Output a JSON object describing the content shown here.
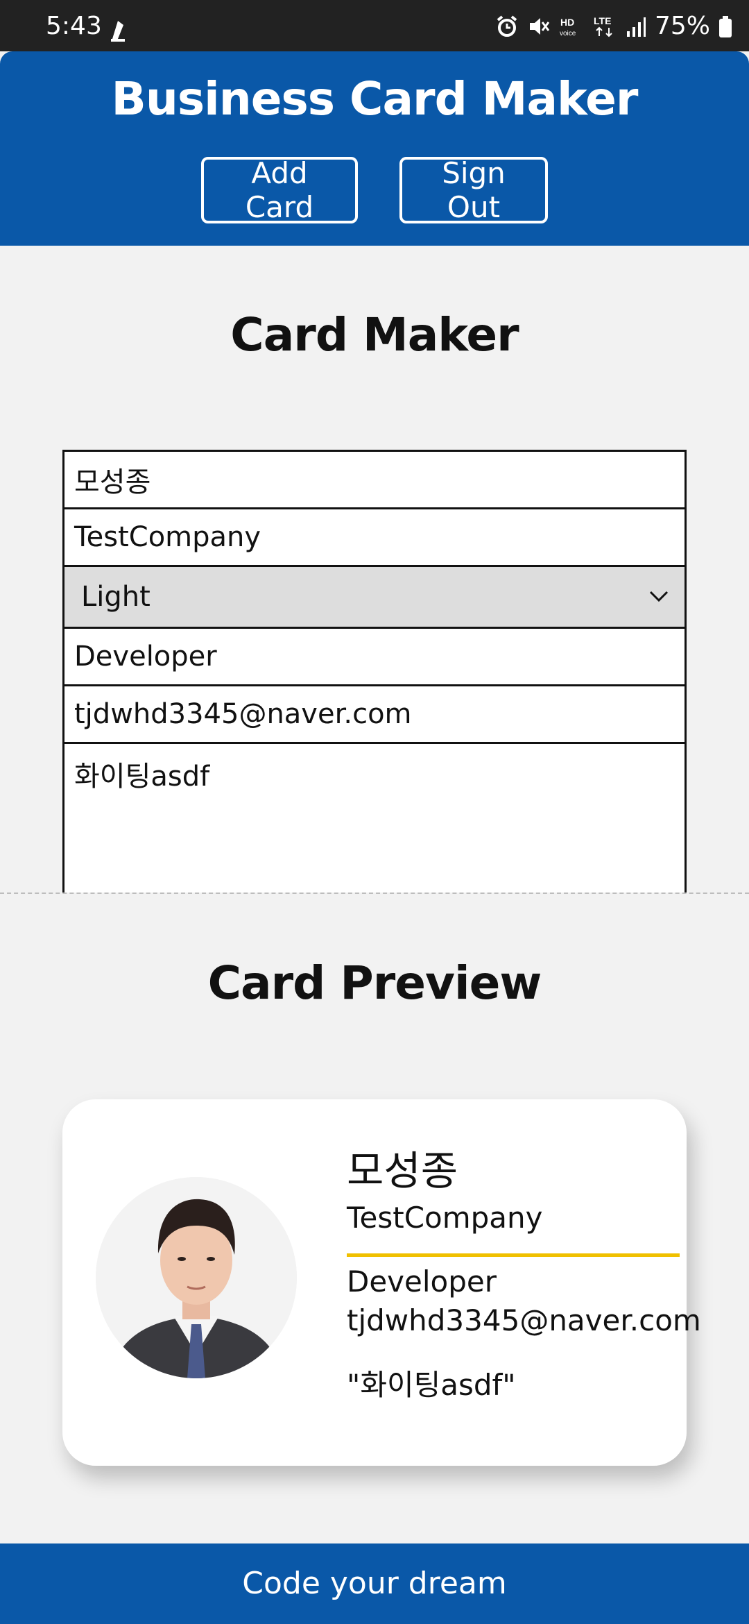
{
  "status_bar": {
    "time": "5:43",
    "battery": "75%",
    "icons": [
      "notification-icon",
      "alarm-icon",
      "mute-icon",
      "hd-voice-icon",
      "lte-icon",
      "signal-icon",
      "battery-icon"
    ]
  },
  "header": {
    "title": "Business Card Maker",
    "add_card_label": "Add Card",
    "sign_out_label": "Sign Out"
  },
  "maker": {
    "title": "Card Maker",
    "name_value": "모성종",
    "company_value": "TestCompany",
    "theme_value": "Light",
    "job_title_value": "Developer",
    "email_value": "tjdwhd3345@naver.com",
    "message_value": "화이팅asdf"
  },
  "preview": {
    "title": "Card Preview",
    "card": {
      "name": "모성종",
      "company": "TestCompany",
      "job_title": "Developer",
      "email": "tjdwhd3345@naver.com",
      "message": "\"화이팅asdf\""
    }
  },
  "footer": {
    "text": "Code your dream"
  },
  "colors": {
    "brand_blue": "#0a58a8",
    "accent_yellow": "#f0c000",
    "background": "#f2f2f2",
    "status_bar": "#222222"
  }
}
